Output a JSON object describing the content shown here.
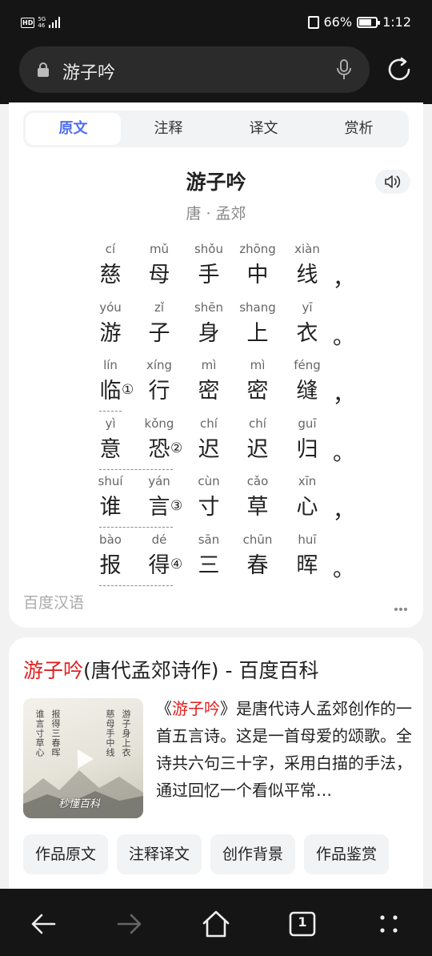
{
  "status": {
    "battery": "66%",
    "battery_level": 0.66,
    "time": "1:12",
    "network_top": "5G",
    "network_bottom": "46",
    "hd": "HD"
  },
  "search": {
    "query": "游子吟"
  },
  "tabs": [
    {
      "label": "原文",
      "active": true
    },
    {
      "label": "注释",
      "active": false
    },
    {
      "label": "译文",
      "active": false
    },
    {
      "label": "赏析",
      "active": false
    }
  ],
  "poem": {
    "title": "游子吟",
    "author": "唐 · 孟郊",
    "lines": [
      {
        "chars": [
          {
            "py": "cí",
            "hz": "慈"
          },
          {
            "py": "mǔ",
            "hz": "母"
          },
          {
            "py": "shǒu",
            "hz": "手"
          },
          {
            "py": "zhōng",
            "hz": "中"
          },
          {
            "py": "xiàn",
            "hz": "线"
          }
        ],
        "punc": "，",
        "note": ""
      },
      {
        "chars": [
          {
            "py": "yóu",
            "hz": "游"
          },
          {
            "py": "zǐ",
            "hz": "子"
          },
          {
            "py": "shēn",
            "hz": "身"
          },
          {
            "py": "shang",
            "hz": "上"
          },
          {
            "py": "yī",
            "hz": "衣"
          }
        ],
        "punc": "。",
        "note": ""
      },
      {
        "chars": [
          {
            "py": "lín",
            "hz": "临"
          },
          {
            "py": "xíng",
            "hz": "行"
          },
          {
            "py": "mì",
            "hz": "密"
          },
          {
            "py": "mì",
            "hz": "密"
          },
          {
            "py": "féng",
            "hz": "缝"
          }
        ],
        "punc": "，",
        "note": "①"
      },
      {
        "chars": [
          {
            "py": "yì",
            "hz": "意"
          },
          {
            "py": "kǒng",
            "hz": "恐"
          },
          {
            "py": "chí",
            "hz": "迟"
          },
          {
            "py": "chí",
            "hz": "迟"
          },
          {
            "py": "guī",
            "hz": "归"
          }
        ],
        "punc": "。",
        "note": "②"
      },
      {
        "chars": [
          {
            "py": "shuí",
            "hz": "谁"
          },
          {
            "py": "yán",
            "hz": "言"
          },
          {
            "py": "cùn",
            "hz": "寸"
          },
          {
            "py": "cǎo",
            "hz": "草"
          },
          {
            "py": "xīn",
            "hz": "心"
          }
        ],
        "punc": "，",
        "note": "③"
      },
      {
        "chars": [
          {
            "py": "bào",
            "hz": "报"
          },
          {
            "py": "dé",
            "hz": "得"
          },
          {
            "py": "sān",
            "hz": "三"
          },
          {
            "py": "chūn",
            "hz": "春"
          },
          {
            "py": "huī",
            "hz": "晖"
          }
        ],
        "punc": "。",
        "note": "④"
      }
    ],
    "source": "百度汉语"
  },
  "baike": {
    "title_hl": "游子吟",
    "title_rest": "(唐代孟郊诗作) - 百度百科",
    "desc_pre": "《",
    "desc_hl": "游子吟",
    "desc_post": "》是唐代诗人孟郊创作的一首五言诗。这是一首母爱的颂歌。全诗共六句三十字，采用白描的手法，通过回忆一个看似平常…",
    "video_logo": "秒懂百科",
    "chips": [
      "作品原文",
      "注释译文",
      "创作背景",
      "作品鉴赏"
    ]
  },
  "nav": {
    "tab_count": "1"
  },
  "colors": {
    "accent": "#4e6ef2",
    "highlight": "#e02020"
  }
}
